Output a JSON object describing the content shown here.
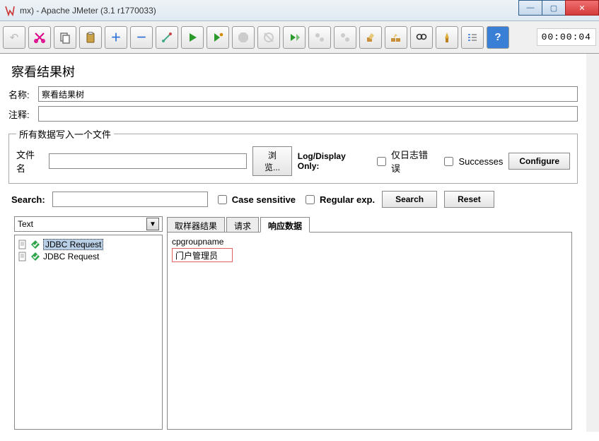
{
  "window": {
    "title": "mx) - Apache JMeter (3.1 r1770033)"
  },
  "toolbar": {
    "timer": "00:00:04"
  },
  "panel": {
    "title": "察看结果树",
    "name_label": "名称:",
    "name_value": "察看结果树",
    "comment_label": "注释:",
    "comment_value": ""
  },
  "file_group": {
    "legend": "所有数据写入一个文件",
    "filename_label": "文件名",
    "filename_value": "",
    "browse": "浏览...",
    "display_label": "Log/Display Only:",
    "only_errors": "仅日志错误",
    "successes": "Successes",
    "configure": "Configure"
  },
  "search": {
    "label": "Search:",
    "value": "",
    "case_sensitive": "Case sensitive",
    "regex": "Regular exp.",
    "search_btn": "Search",
    "reset_btn": "Reset"
  },
  "tree": {
    "renderer": "Text",
    "items": [
      {
        "label": "JDBC Request",
        "selected": true
      },
      {
        "label": "JDBC Request",
        "selected": false
      }
    ]
  },
  "tabs": {
    "sampler_result": "取样器结果",
    "request": "请求",
    "response_data": "响应数据"
  },
  "response": {
    "header": "cpgroupname",
    "value": "门户管理员"
  }
}
